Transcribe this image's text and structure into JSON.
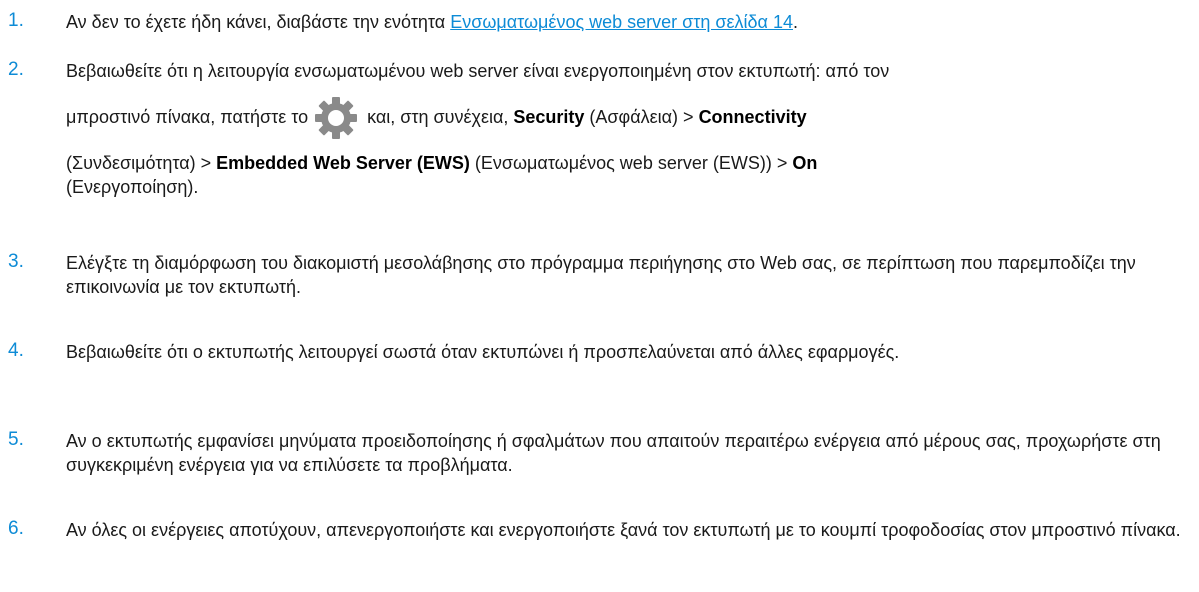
{
  "steps": [
    {
      "num": "1.",
      "pre": "Αν δεν το έχετε ήδη κάνει, διαβάστε την ενότητα ",
      "link": "Ενσωματωμένος web server στη σελίδα 14",
      "post": "."
    },
    {
      "num": "2.",
      "line1": "Βεβαιωθείτε ότι η λειτουργία ενσωματωμένου web server είναι ενεργοποιημένη στον εκτυπωτή: από τον",
      "line2_pre": "μπροστινό πίνακα, πατήστε το",
      "gear_icon": "gear-icon",
      "line2_post": " και, στη συνέχεια, ",
      "security": "Security",
      "security_gr": " (Ασφάλεια) > ",
      "connectivity": "Connectivity",
      "line3_pre": "(Συνδεσιμότητα) > ",
      "ews": "Embedded Web Server (EWS)",
      "ews_gr": " (Ενσωματωμένος web server (EWS)) > ",
      "on": "On",
      "line4": "(Ενεργοποίηση)."
    },
    {
      "num": "3.",
      "text": "Ελέγξτε τη διαμόρφωση του διακομιστή μεσολάβησης στο πρόγραμμα περιήγησης στο Web σας, σε περίπτωση που παρεμποδίζει την επικοινωνία με τον εκτυπωτή."
    },
    {
      "num": "4.",
      "text": "Βεβαιωθείτε ότι ο εκτυπωτής λειτουργεί σωστά όταν εκτυπώνει ή προσπελαύνεται από άλλες εφαρμογές."
    },
    {
      "num": "5.",
      "text": "Αν ο εκτυπωτής εμφανίσει μηνύματα προειδοποίησης ή σφαλμάτων που απαιτούν περαιτέρω ενέργεια από μέρους σας, προχωρήστε στη συγκεκριμένη ενέργεια για να επιλύσετε τα προβλήματα."
    },
    {
      "num": "6.",
      "text": "Αν όλες οι ενέργειες αποτύχουν, απενεργοποιήστε και ενεργοποιήστε ξανά τον εκτυπωτή με το κουμπί τροφοδοσίας στον μπροστινό πίνακα."
    }
  ],
  "colors": {
    "accent": "#0d8bd6",
    "text": "#1a1a1a",
    "gear": "#8a8a8a"
  }
}
